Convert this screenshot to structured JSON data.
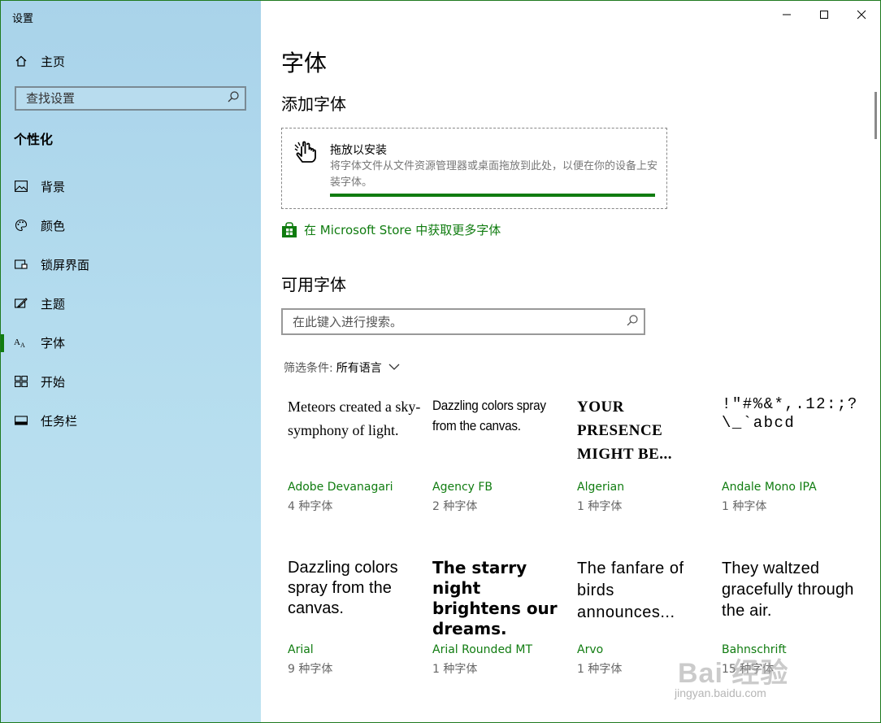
{
  "app": {
    "title": "设置",
    "colors": {
      "accent": "#107c10",
      "sidebar": "#b2dbee"
    }
  },
  "sidebar": {
    "home": {
      "label": "主页",
      "icon": "home-icon"
    },
    "search": {
      "placeholder": "查找设置",
      "icon": "search-icon"
    },
    "section_title": "个性化",
    "items": [
      {
        "label": "背景",
        "icon": "picture-icon",
        "active": false
      },
      {
        "label": "颜色",
        "icon": "palette-icon",
        "active": false
      },
      {
        "label": "锁屏界面",
        "icon": "lock-screen-icon",
        "active": false
      },
      {
        "label": "主题",
        "icon": "theme-brush-icon",
        "active": false
      },
      {
        "label": "字体",
        "icon": "font-icon",
        "active": true
      },
      {
        "label": "开始",
        "icon": "start-grid-icon",
        "active": false
      },
      {
        "label": "任务栏",
        "icon": "taskbar-icon",
        "active": false
      }
    ]
  },
  "window_controls": [
    "minimize-icon",
    "maximize-icon",
    "close-icon"
  ],
  "main": {
    "page_title": "字体",
    "add_fonts": {
      "title": "添加字体",
      "drop_title": "拖放以安装",
      "drop_description": "将字体文件从文件资源管理器或桌面拖放到此处，以便在你的设备上安装字体。",
      "icon": "hand-drag-icon"
    },
    "store_link": {
      "label": "在 Microsoft Store 中获取更多字体",
      "icon": "store-bag-icon"
    },
    "available": {
      "title": "可用字体",
      "search_placeholder": "在此键入进行搜索。",
      "filter_label": "筛选条件:",
      "filter_value": "所有语言"
    },
    "fonts": [
      {
        "sample": "Meteors created a sky-symphony of light.",
        "name": "Adobe Devanagari",
        "count": "4 种字体"
      },
      {
        "sample": "Dazzling colors spray from the canvas.",
        "name": "Agency FB",
        "count": "2 种字体"
      },
      {
        "sample": "YOUR PRESENCE MIGHT BE...",
        "name": "Algerian",
        "count": "1 种字体"
      },
      {
        "sample": "!\"#%&*,.12:;?\\_`abcd",
        "name": "Andale Mono IPA",
        "count": "1 种字体"
      },
      {
        "sample": "Dazzling colors spray from the canvas.",
        "name": "Arial",
        "count": "9 种字体"
      },
      {
        "sample": "The starry night brightens our dreams.",
        "name": "Arial Rounded MT",
        "count": "1 种字体"
      },
      {
        "sample": "The fanfare of birds announces...",
        "name": "Arvo",
        "count": "1 种字体"
      },
      {
        "sample": "They waltzed gracefully through the air.",
        "name": "Bahnschrift",
        "count": "15 种字体"
      }
    ]
  },
  "watermark": {
    "text": "Bai 经验",
    "url": "jingyan.baidu.com"
  }
}
